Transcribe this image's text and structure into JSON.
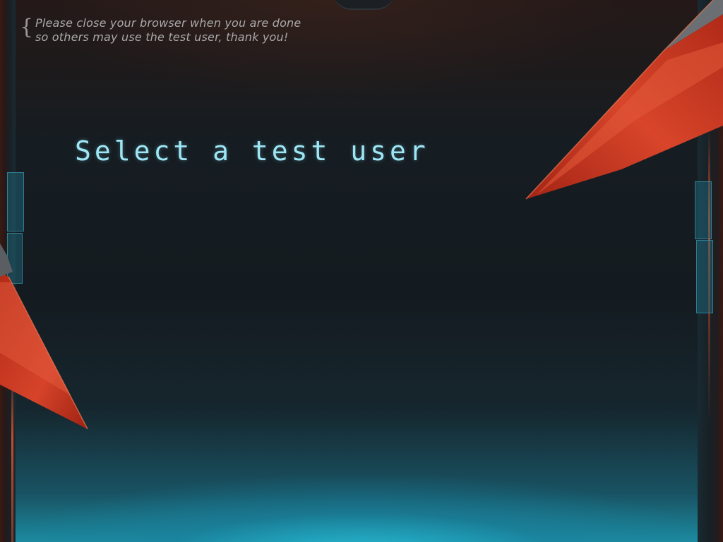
{
  "notice": {
    "brace": "{",
    "line1": "Please close your browser when you are done",
    "line2": "so others may use the test user, thank you!"
  },
  "title": "Select a test user",
  "colors": {
    "title": "#9fe6f5",
    "notice": "#a9a9a9",
    "blade": "#c8331c",
    "accent_teal": "#1c8ba0"
  },
  "icons": {
    "left_blade": "red-blade-decoration",
    "right_blade": "red-blade-decoration"
  }
}
